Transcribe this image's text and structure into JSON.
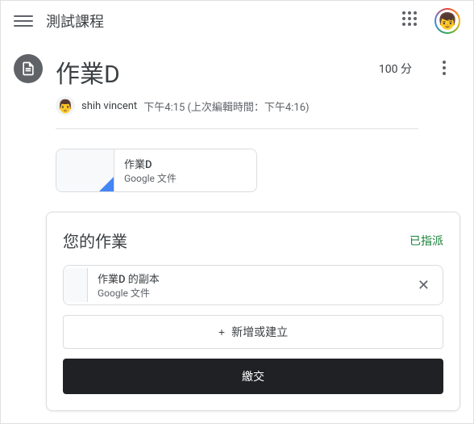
{
  "header": {
    "course_title": "測試課程"
  },
  "assignment": {
    "title": "作業D",
    "score": "100 分",
    "author": "shih vincent",
    "time": "下午4:15 (上次編輯時間：下午4:16)",
    "attachment": {
      "title": "作業D",
      "type": "Google 文件"
    }
  },
  "your_work": {
    "title": "您的作業",
    "status": "已指派",
    "attachment": {
      "title": "作業D 的副本",
      "type": "Google 文件"
    },
    "add_button": "新增或建立",
    "submit_button": "繳交"
  }
}
